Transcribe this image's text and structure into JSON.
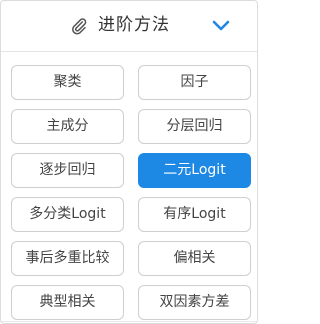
{
  "header": {
    "title": "进阶方法",
    "left_icon": "paperclip-icon",
    "right_icon": "chevron-down-icon"
  },
  "colors": {
    "accent": "#1e88e5",
    "border": "#cfcfcf",
    "text": "#444444"
  },
  "methods": [
    {
      "label": "聚类",
      "active": false
    },
    {
      "label": "因子",
      "active": false
    },
    {
      "label": "主成分",
      "active": false
    },
    {
      "label": "分层回归",
      "active": false
    },
    {
      "label": "逐步回归",
      "active": false
    },
    {
      "label": "二元Logit",
      "active": true
    },
    {
      "label": "多分类Logit",
      "active": false
    },
    {
      "label": "有序Logit",
      "active": false
    },
    {
      "label": "事后多重比较",
      "active": false
    },
    {
      "label": "偏相关",
      "active": false
    },
    {
      "label": "典型相关",
      "active": false
    },
    {
      "label": "双因素方差",
      "active": false
    }
  ]
}
